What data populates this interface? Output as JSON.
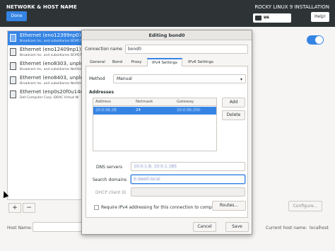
{
  "header": {
    "title": "NETWORK & HOST NAME",
    "done_label": "Done",
    "install_title": "ROCKY LINUX 9 INSTALLATION",
    "keyboard_layout": "us",
    "help_label": "Help!"
  },
  "devices": [
    {
      "name": "Ethernet (eno12399np0)",
      "vendor": "Broadcom Inc. and subsidiaries BCM57",
      "selected": true
    },
    {
      "name": "Ethernet (eno12409np1)",
      "vendor": "Broadcom Inc. and subsidiaries BCM57",
      "selected": false
    },
    {
      "name": "Ethernet (eno8303, unplu",
      "vendor": "Broadcom Inc. and subsidiaries NetXtre",
      "selected": false
    },
    {
      "name": "Ethernet (eno8403, unplu",
      "vendor": "Broadcom Inc. and subsidiaries NetXtre",
      "selected": false
    },
    {
      "name": "Ethernet (enp0s20f0u14u",
      "vendor": "Dell Computer Corp. iDRAC Virtual NI",
      "selected": false
    }
  ],
  "main": {
    "add_label": "+",
    "remove_label": "−",
    "configure_label": "Configure...",
    "host_name_label": "Host Name:",
    "current_host_label": "Current host name:",
    "current_host_value": "localhost"
  },
  "dialog": {
    "title": "Editing bond0",
    "connection_name_label": "Connection name",
    "connection_name_value": "bond0",
    "tabs": [
      "General",
      "Bond",
      "Proxy",
      "IPv4 Settings",
      "IPv6 Settings"
    ],
    "active_tab": "IPv4 Settings",
    "method_label": "Method",
    "method_value": "Manual",
    "addresses_label": "Addresses",
    "columns": [
      "Address",
      "Netmask",
      "Gateway"
    ],
    "address_rows": [
      {
        "address": "10.0.56.28",
        "netmask": "24",
        "gateway": "10.0.56.250"
      }
    ],
    "add_label": "Add",
    "delete_label": "Delete",
    "dns_label": "DNS servers",
    "dns_value": "10.0.1.8, 10.0.1.185",
    "search_domains_label": "Search domains",
    "search_domains_value": "it.dwell.local",
    "dhcp_label": "DHCP client ID",
    "require_ipv4_label": "Require IPv4 addressing for this connection to complete",
    "routes_label": "Routes...",
    "cancel_label": "Cancel",
    "save_label": "Save"
  },
  "colors": {
    "accent": "#3584e4",
    "header_bg": "#2e3436"
  }
}
